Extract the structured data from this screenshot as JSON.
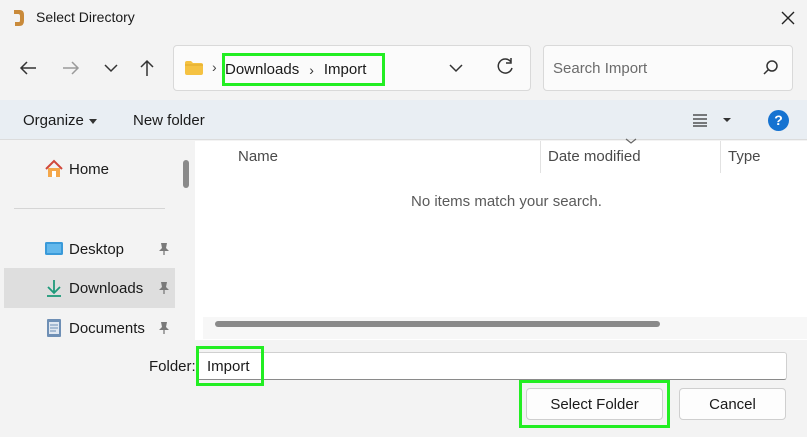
{
  "window": {
    "title": "Select Directory"
  },
  "nav": {
    "breadcrumbs": [
      "Downloads",
      "Import"
    ],
    "separator": "›"
  },
  "search": {
    "placeholder": "Search Import"
  },
  "toolbar": {
    "organize_label": "Organize",
    "new_folder_label": "New folder",
    "help_label": "?"
  },
  "sidebar": {
    "items": [
      {
        "label": "Home",
        "icon": "home-icon",
        "pinned": false
      },
      {
        "label": "Desktop",
        "icon": "desktop-icon",
        "pinned": true
      },
      {
        "label": "Downloads",
        "icon": "download-icon",
        "pinned": true,
        "selected": true
      },
      {
        "label": "Documents",
        "icon": "documents-icon",
        "pinned": true
      }
    ]
  },
  "columns": [
    "Name",
    "Date modified",
    "Type"
  ],
  "files": {
    "empty_message": "No items match your search."
  },
  "footer": {
    "folder_label": "Folder:",
    "folder_value": "Import",
    "select_button": "Select Folder",
    "cancel_button": "Cancel"
  },
  "colors": {
    "highlight": "#22ee22",
    "accent": "#1673d1",
    "folder": "#f5c242"
  }
}
